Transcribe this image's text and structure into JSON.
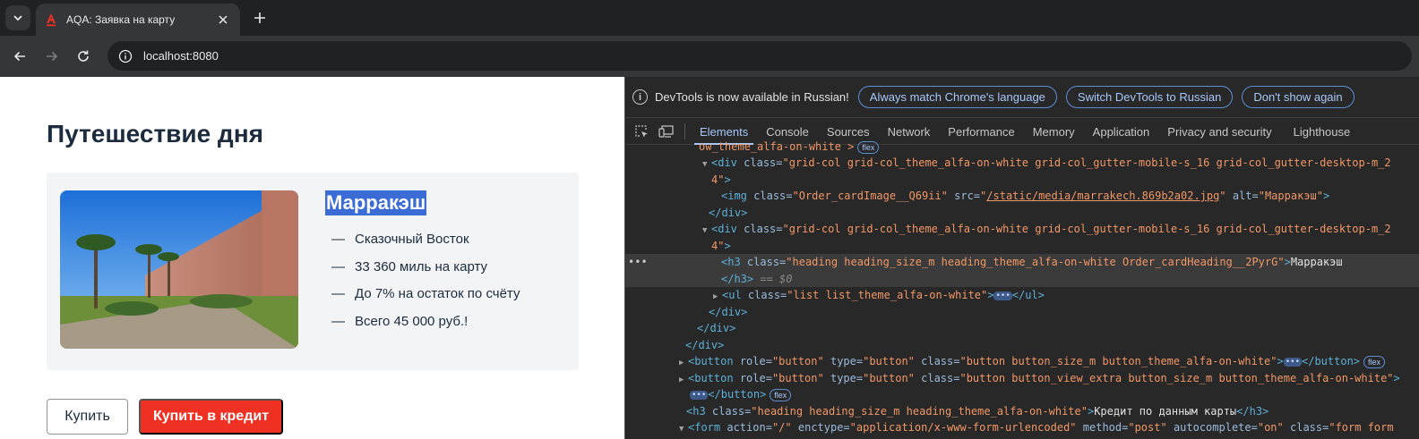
{
  "browser": {
    "tab_title": "AQA: Заявка на карту",
    "url": "localhost:8080"
  },
  "page": {
    "title": "Путешествие дня",
    "card": {
      "heading": "Марракэш",
      "items": [
        {
          "dash": "—",
          "text": "Сказочный Восток"
        },
        {
          "dash": "—",
          "text": "33 360 миль на карту"
        },
        {
          "dash": "—",
          "text": "До 7% на остаток по счёту"
        },
        {
          "dash": "—",
          "text": "Всего 45 000 руб.!"
        }
      ]
    },
    "buy_label": "Купить",
    "credit_label": "Купить в кредит",
    "colors": {
      "accent": "#ef3124",
      "selection": "#3b6bd5"
    }
  },
  "devtools": {
    "infobar": {
      "icon": "i",
      "text": "DevTools is now available in Russian!",
      "btn_match": "Always match Chrome's language",
      "btn_switch": "Switch DevTools to Russian",
      "btn_dismiss": "Don't show again"
    },
    "tabs": [
      "Elements",
      "Console",
      "Sources",
      "Network",
      "Performance",
      "Memory",
      "Application",
      "Privacy and security",
      "Lighthouse"
    ],
    "dom": {
      "l0_text": "ow_theme_alfa-on-white >",
      "flex": "flex",
      "div_open": "<div",
      "class_attr": "class=",
      "grid_class_a": "\"grid-col grid-col_theme_alfa-on-white grid-col_gutter-mobile-s_16 grid-col_gutter-desktop-m_2",
      "grid_class_b": "4\"",
      "gt": ">",
      "img_open": "<img",
      "img_class": "\"Order_cardImage__Q69ii\"",
      "src_attr": "src=",
      "img_src": "/static/media/marrakech.869b2a02.jpg",
      "alt_attr": "alt=",
      "img_alt": "\"Марракэш\"",
      "div_close": "</div>",
      "h3_open": "<h3",
      "h3_class": "\"heading heading_size_m heading_theme_alfa-on-white Order_cardHeading__2PyrG\"",
      "h3_text": "Марракэш",
      "h3_close": "</h3>",
      "eq0": "== $0",
      "ul_open": "<ul",
      "ul_class": "\"list list_theme_alfa-on-white\"",
      "ul_close": "</ul>",
      "ellipsis": "•••",
      "button_open": "<button",
      "role_attr": "role=",
      "role_val": "\"button\"",
      "type_attr": "type=",
      "type_val": "\"button\"",
      "btn1_class": "\"button button_size_m button_theme_alfa-on-white\"",
      "btn2_class": "\"button button_view_extra button_size_m button_theme_alfa-on-white\"",
      "button_close": "</button>",
      "h3b_class": "\"heading heading_size_m heading_theme_alfa-on-white\"",
      "h3b_text": "Кредит по данным карты",
      "form_open": "<form",
      "action_attr": "action=",
      "action_val": "\"/\"",
      "enctype_attr": "enctype=",
      "enctype_val": "\"application/x-www-form-urlencoded\"",
      "method_attr": "method=",
      "method_val": "\"post\"",
      "autocomplete_attr": "autocomplete=",
      "autocomplete_val": "\"on\"",
      "form_class_val": "\"form form"
    }
  }
}
